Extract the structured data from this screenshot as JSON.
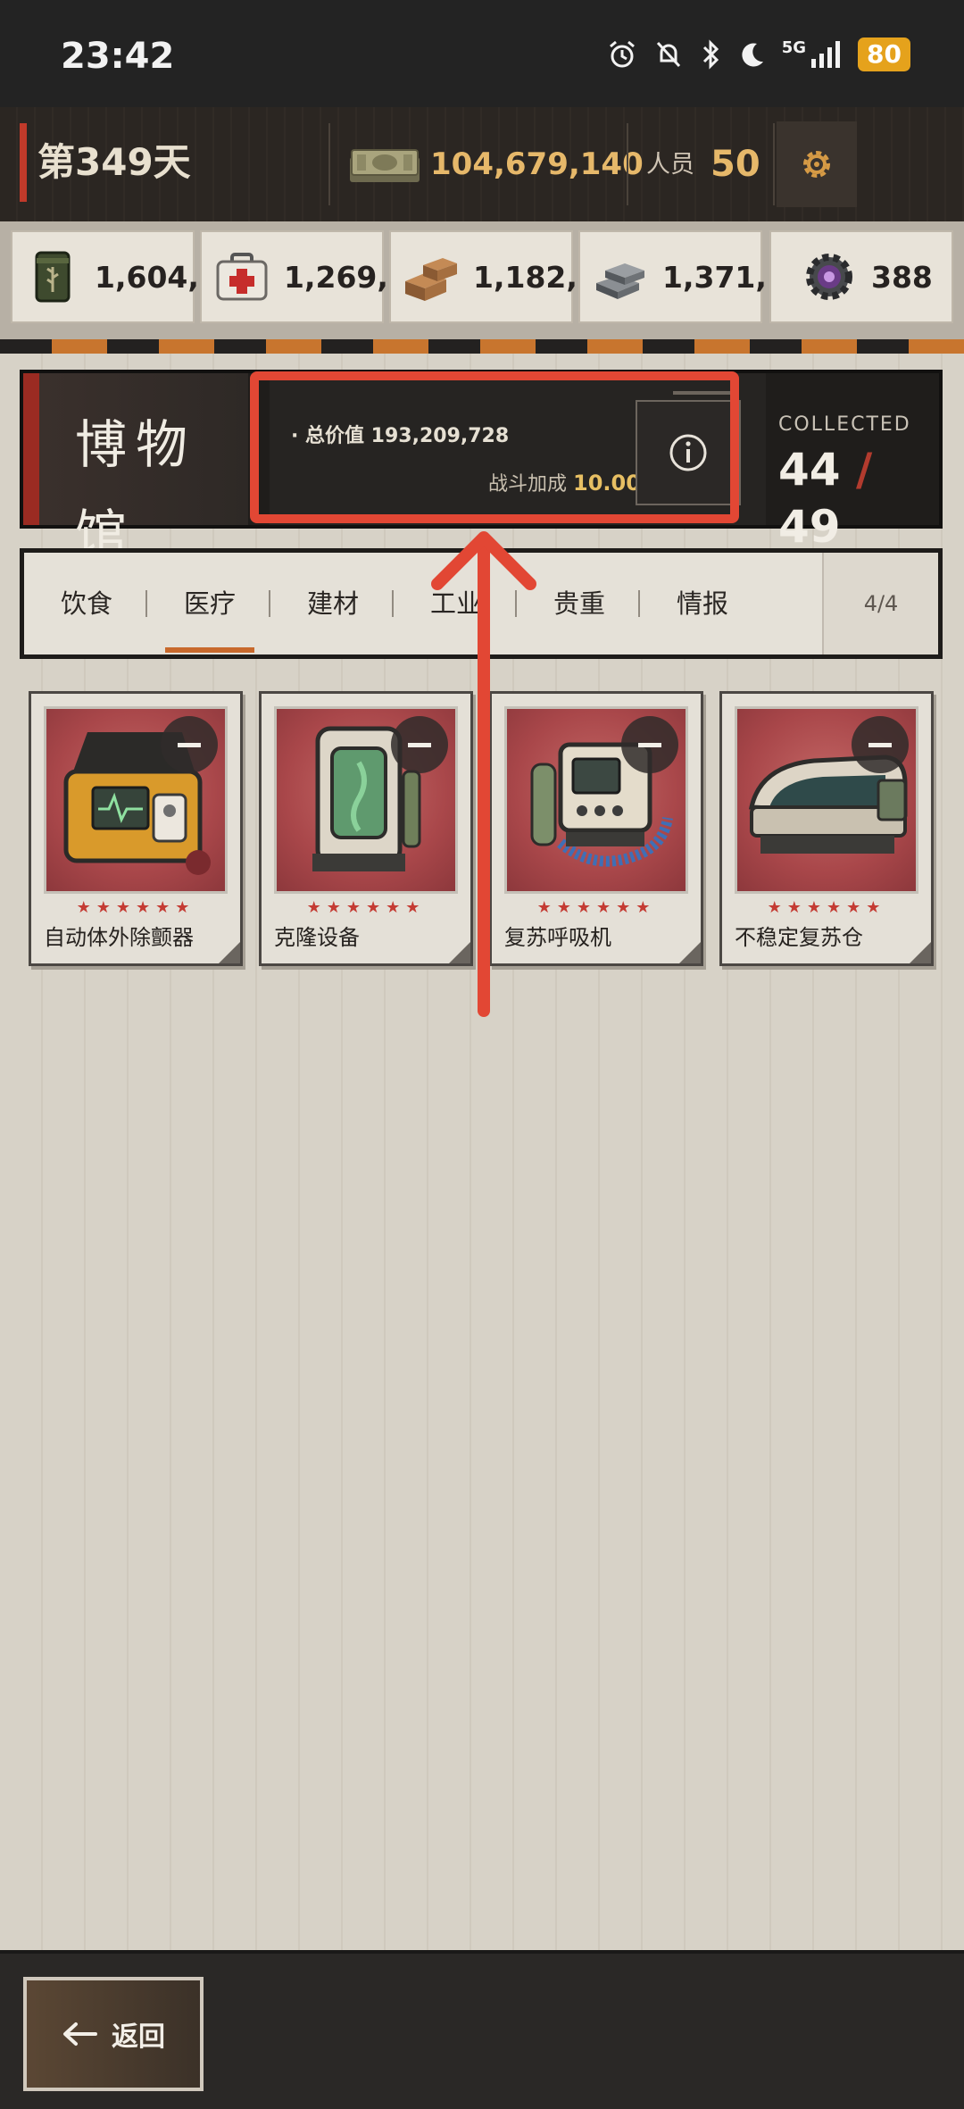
{
  "status_bar": {
    "time": "23:42",
    "network": "5G",
    "battery": "80",
    "icons": [
      "alarm-icon",
      "mute-bell-icon",
      "bluetooth-icon",
      "moon-icon",
      "signal-icon",
      "battery-icon"
    ]
  },
  "header": {
    "day": "第349天",
    "money": "104,679,140",
    "people_label": "人员",
    "people_value": "50",
    "settings_icon": "gear-icon"
  },
  "resources": [
    {
      "icon": "food-can-icon",
      "value": "1,604,..."
    },
    {
      "icon": "medkit-icon",
      "value": "1,269,..."
    },
    {
      "icon": "bricks-icon",
      "value": "1,182,..."
    },
    {
      "icon": "metal-ingots-icon",
      "value": "1,371,..."
    },
    {
      "icon": "gear-chip-icon",
      "value": "388"
    }
  ],
  "museum": {
    "title": "博物馆",
    "total_value_label": "· 总价值 193,209,728",
    "battle_bonus_label": "战斗加成",
    "battle_bonus_value": "10.00%",
    "collected_label": "COLLECTED",
    "collected_count": "44",
    "collected_total": "49"
  },
  "tabs": {
    "items": [
      "饮食",
      "医疗",
      "建材",
      "工业",
      "贵重",
      "情报"
    ],
    "active": "医疗",
    "page": "4/4"
  },
  "items": [
    {
      "name": "自动体外除颤器",
      "stars": "★★★★★★"
    },
    {
      "name": "克隆设备",
      "stars": "★★★★★★"
    },
    {
      "name": "复苏呼吸机",
      "stars": "★★★★★★"
    },
    {
      "name": "不稳定复苏仓",
      "stars": "★★★★★★"
    }
  ],
  "bottom": {
    "back_label": "返回"
  },
  "colors": {
    "highlight": "#e24734",
    "accent_gold": "#e6b86a",
    "tab_active": "#c8692c",
    "star": "#c43b33"
  }
}
